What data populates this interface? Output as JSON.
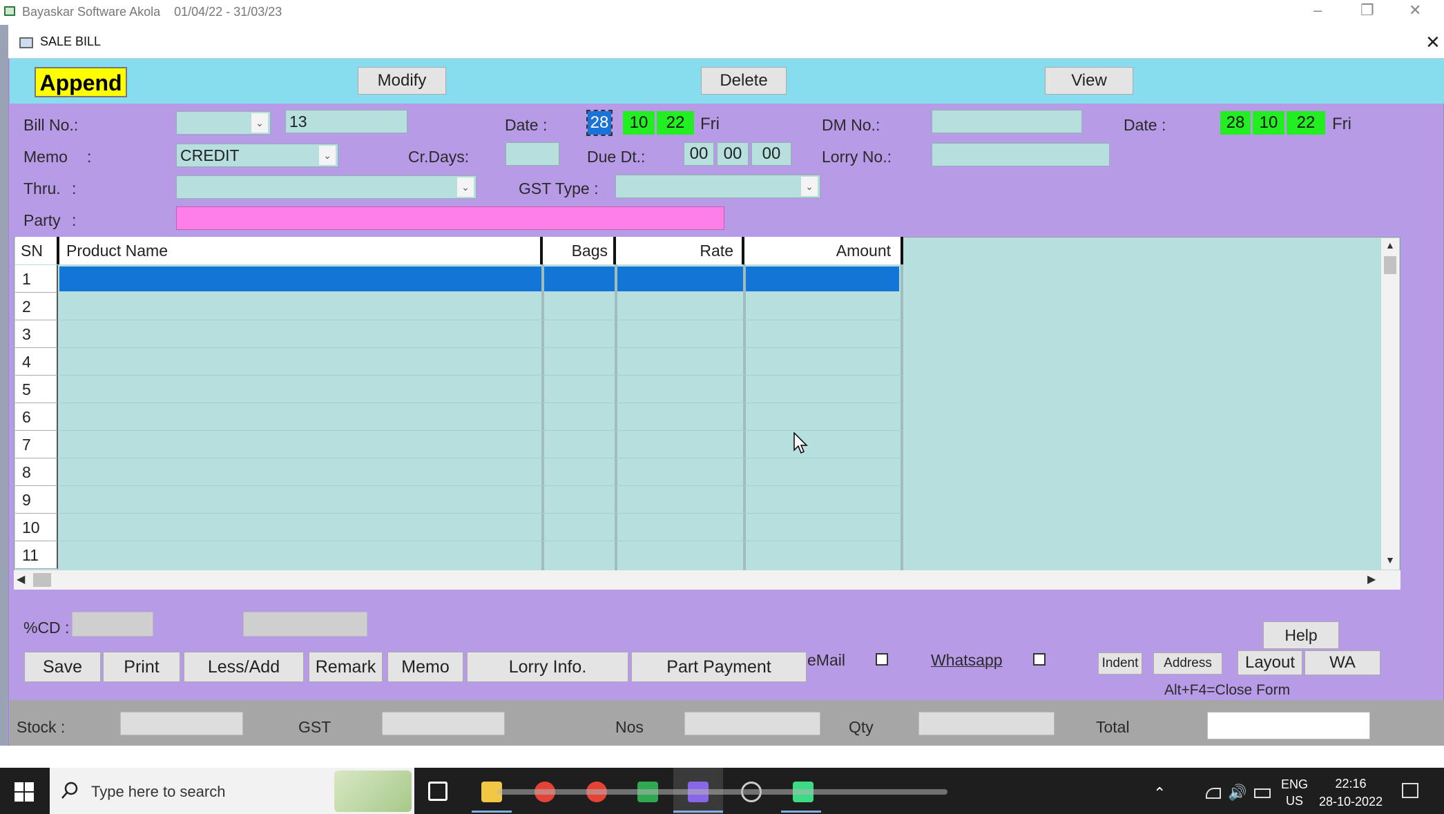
{
  "outer_window": {
    "title": "Bayaskar Software Akola",
    "period": "01/04/22 - 31/03/23",
    "controls": [
      "–",
      "❐",
      "✕"
    ]
  },
  "form": {
    "title": "SALE BILL",
    "close": "✕"
  },
  "toolbar": {
    "append": "Append",
    "modify": "Modify",
    "delete": "Delete",
    "view": "View"
  },
  "header_fields": {
    "bill_no_label": "Bill No.:",
    "bill_no_series": "",
    "bill_no": "13",
    "date_label": "Date :",
    "date_dd": "28",
    "date_mm": "10",
    "date_yy": "22",
    "date_day": "Fri",
    "dm_no_label": "DM No.:",
    "dm_no": "",
    "date2_label": "Date :",
    "date2_dd": "28",
    "date2_mm": "10",
    "date2_yy": "22",
    "date2_day": "Fri",
    "memo_label": "Memo",
    "memo_colon": ":",
    "memo_value": "CREDIT",
    "cr_days_label": "Cr.Days:",
    "cr_days": "",
    "due_dt_label": "Due Dt.:",
    "due_dd": "00",
    "due_mm": "00",
    "due_yy": "00",
    "lorry_no_label": "Lorry No.:",
    "lorry_no": "",
    "thru_label": "Thru.",
    "thru_colon": ":",
    "thru_value": "",
    "gst_type_label": "GST Type :",
    "gst_type_value": "",
    "party_label": "Party",
    "party_colon": ":",
    "party_value": ""
  },
  "grid": {
    "columns": [
      "SN",
      "Product Name",
      "Bags",
      "Rate",
      "Amount"
    ],
    "rows": [
      "1",
      "2",
      "3",
      "4",
      "5",
      "6",
      "7",
      "8",
      "9",
      "10",
      "11"
    ],
    "selected_row": "1"
  },
  "footer": {
    "cd_label": "%CD :",
    "cd_value": "",
    "extra_value": "",
    "help": "Help",
    "buttons": [
      "Save",
      "Print",
      "Less/Add",
      "Remark",
      "Memo",
      "Lorry Info.",
      "Part Payment"
    ],
    "email_label": "eMail",
    "whatsapp_label": "Whatsapp",
    "indent": "Indent",
    "address": "Address",
    "layout": "Layout",
    "wa": "WA",
    "close_hint": "Alt+F4=Close Form"
  },
  "status_bar": {
    "stock_label": "Stock :",
    "gst_label": "GST",
    "nos_label": "Nos",
    "qty_label": "Qty",
    "total_label": "Total"
  },
  "taskbar": {
    "search_placeholder": "Type here to search",
    "lang_top": "ENG",
    "lang_bottom": "US",
    "time": "22:16",
    "date": "28-10-2022"
  },
  "colors": {
    "form_bg": "#b89be6",
    "toolbar_bg": "#87dced",
    "field_bg": "#b6dfde",
    "party_bg": "#ff7fe8",
    "date_bg": "#22ee22",
    "append_bg": "#ffff00",
    "selection": "#1375d6"
  }
}
